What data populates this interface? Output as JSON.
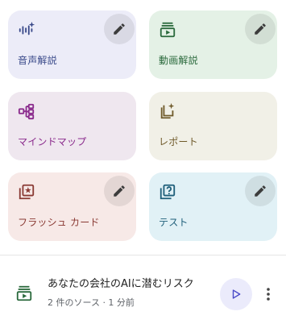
{
  "cards": {
    "audio": {
      "label": "音声解説",
      "icon": "audio-waveform-icon",
      "color": "#3a4a8a",
      "has_edit": true
    },
    "video": {
      "label": "動画解説",
      "icon": "video-slides-icon",
      "color": "#2b6a3d",
      "has_edit": true
    },
    "mindmap": {
      "label": "マインドマップ",
      "icon": "mindmap-icon",
      "color": "#8a2a8c",
      "has_edit": false
    },
    "report": {
      "label": "レポート",
      "icon": "report-icon",
      "color": "#6f5a2a",
      "has_edit": false
    },
    "flash": {
      "label": "フラッシュ カード",
      "icon": "flashcard-icon",
      "color": "#8a3a34",
      "has_edit": true
    },
    "test": {
      "label": "テスト",
      "icon": "quiz-icon",
      "color": "#1f5f7a",
      "has_edit": true
    }
  },
  "edit_icon": "pencil-icon",
  "generated_item": {
    "title": "あなたの会社のAIに潜むリスク",
    "subtitle": "2 件のソース · 1 分前",
    "icon": "video-slides-icon",
    "play_icon": "play-icon",
    "more_icon": "more-vert-icon"
  }
}
